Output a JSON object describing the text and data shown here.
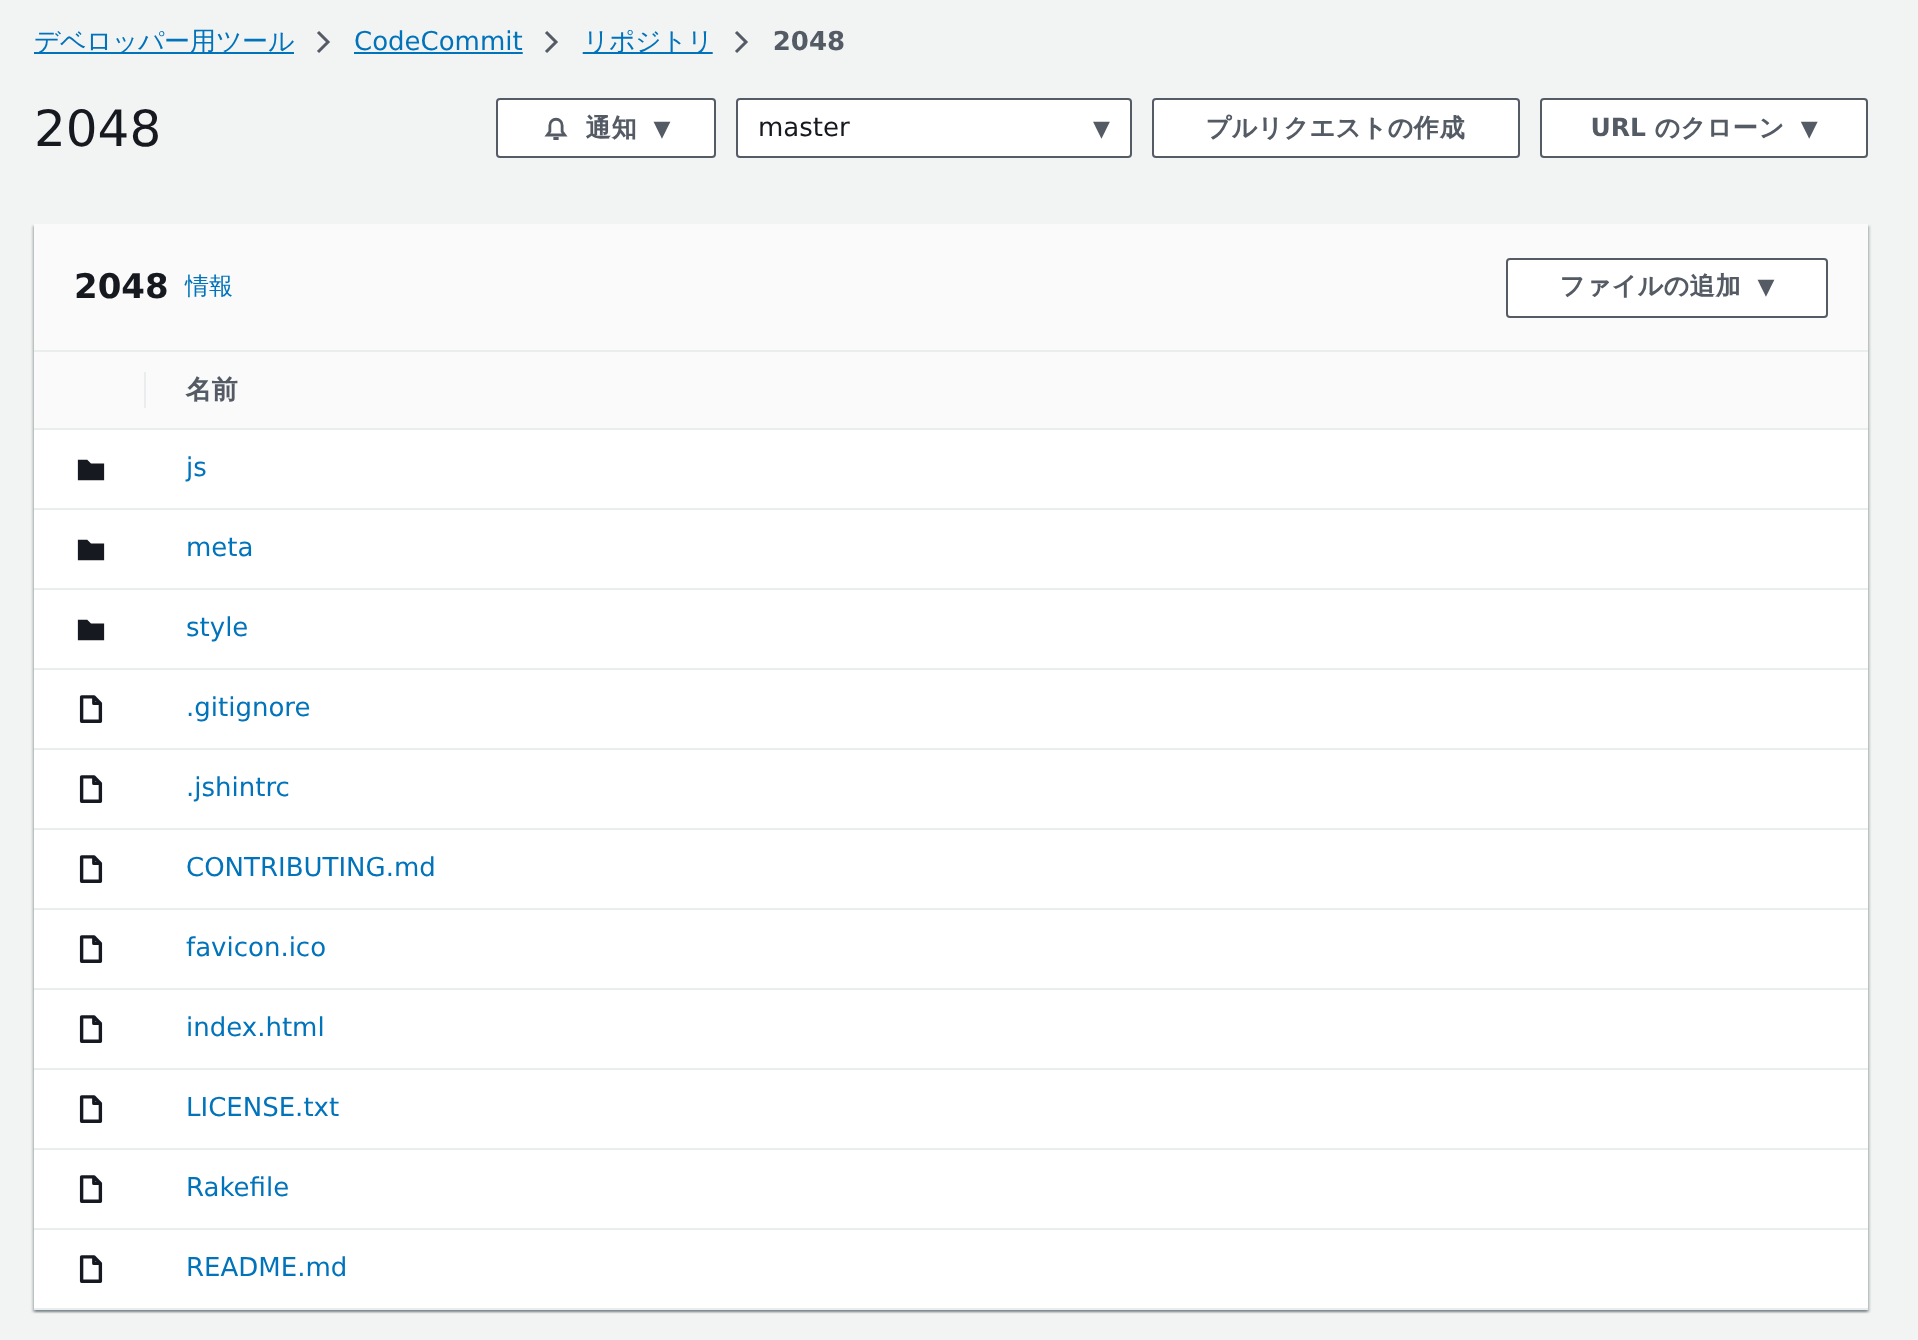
{
  "breadcrumb": {
    "links": [
      "デベロッパー用ツール",
      "CodeCommit",
      "リポジトリ"
    ],
    "current": "2048"
  },
  "title": "2048",
  "actions": {
    "notify": {
      "label": "通知",
      "caret": "▼"
    },
    "branch": {
      "value": "master",
      "caret": "▼"
    },
    "pull_request": "プルリクエストの作成",
    "clone": {
      "label": "URL のクローン",
      "caret": "▼"
    }
  },
  "panel": {
    "title": "2048",
    "info": "情報",
    "add_file": {
      "label": "ファイルの追加",
      "caret": "▼"
    },
    "columns": [
      "名前"
    ],
    "rows": [
      {
        "kind": "folder",
        "name": "js"
      },
      {
        "kind": "folder",
        "name": "meta"
      },
      {
        "kind": "folder",
        "name": "style"
      },
      {
        "kind": "file",
        "name": ".gitignore"
      },
      {
        "kind": "file",
        "name": ".jshintrc"
      },
      {
        "kind": "file",
        "name": "CONTRIBUTING.md"
      },
      {
        "kind": "file",
        "name": "favicon.ico"
      },
      {
        "kind": "file",
        "name": "index.html"
      },
      {
        "kind": "file",
        "name": "LICENSE.txt"
      },
      {
        "kind": "file",
        "name": "Rakefile"
      },
      {
        "kind": "file",
        "name": "README.md"
      }
    ]
  }
}
